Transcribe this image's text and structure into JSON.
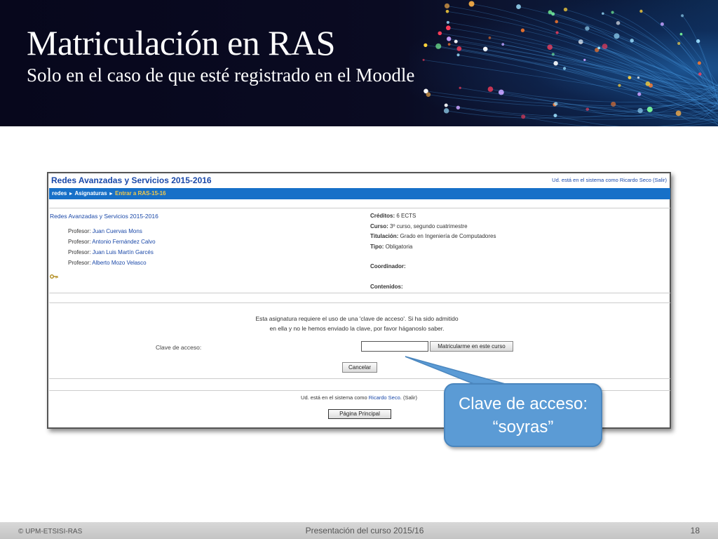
{
  "slide": {
    "title": "Matriculación en RAS",
    "subtitle": "Solo en el caso de que esté registrado en el Moodle"
  },
  "moodle": {
    "course_title": "Redes Avanzadas y Servicios 2015-2016",
    "login_top": {
      "prefix": "Ud. está en el sistema como ",
      "user": "Ricardo Seco",
      "logout": "(Salir)"
    },
    "breadcrumb": {
      "items": [
        "redes",
        "Asignaturas"
      ],
      "current": "Entrar a RAS-15-16",
      "separator": "►"
    },
    "course_name": "Redes Avanzadas y Servicios 2015-2016",
    "professors": [
      {
        "role": "Profesor: ",
        "name": "Juan Cuervas Mons"
      },
      {
        "role": "Profesor: ",
        "name": "Antonio Fernández Calvo"
      },
      {
        "role": "Profesor: ",
        "name": "Juan Luis Martín Garcés"
      },
      {
        "role": "Profesor: ",
        "name": "Alberto Mozo Velasco"
      }
    ],
    "info": {
      "creditos_label": "Créditos:",
      "creditos_value": " 6 ECTS",
      "curso_label": "Curso:",
      "curso_value": " 3º curso, segundo cuatrimestre",
      "titulacion_label": "Titulación:",
      "titulacion_value": " Grado en Ingeniería de Computadores",
      "tipo_label": "Tipo:",
      "tipo_value": " Obligatoria",
      "coordinador_label": "Coordinador:",
      "contenidos_label": "Contenidos:"
    },
    "message_line1": "Esta asignatura requiere el uso de una 'clave de acceso'. Si ha sido admitido",
    "message_line2": "en ella y no le hemos enviado la clave, por favor háganoslo saber.",
    "clave_label": "Clave de acceso:",
    "clave_value": "",
    "enrol_button": "Matricularme en este curso",
    "cancel_button": "Cancelar",
    "login_bottom": {
      "prefix": "Ud. está en el sistema como ",
      "user": "Ricardo Seco",
      "logout": ". (Salir)"
    },
    "home_button": "Página Principal"
  },
  "callout": {
    "line1": "Clave de acceso:",
    "line2": "“soyras”"
  },
  "footer": {
    "copyright": "© UPM-ETSISI-RAS",
    "presentation": "Presentación del curso 2015/16",
    "page_number": "18"
  },
  "colors": {
    "moodle_link": "#1a48a8",
    "moodle_navbar": "#1770c8",
    "breadcrumb_current": "#f2c94c",
    "callout_fill": "#5b9bd5"
  }
}
